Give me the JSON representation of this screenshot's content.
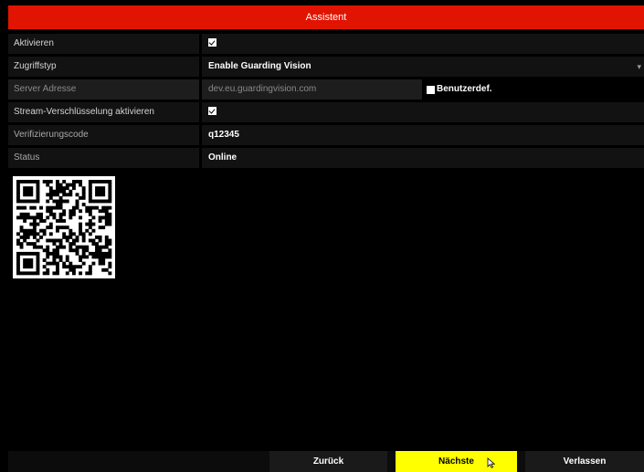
{
  "window": {
    "title": "Assistent"
  },
  "form": {
    "enable": {
      "label": "Aktivieren",
      "checked": true
    },
    "access_type": {
      "label": "Zugriffstyp",
      "value": "Enable Guarding Vision",
      "arrow": "▾"
    },
    "server_address": {
      "label": "Server Adresse",
      "value": "dev.eu.guardingvision.com",
      "custom_label": "Benutzerdef.",
      "custom_checked": false
    },
    "stream_encryption": {
      "label": "Stream-Verschlüsselung aktivieren",
      "checked": true
    },
    "verification_code": {
      "label": "Verifizierungscode",
      "value": "q12345"
    },
    "status": {
      "label": "Status",
      "value": "Online"
    }
  },
  "buttons": {
    "back": "Zurück",
    "next": "Nächste",
    "exit": "Verlassen"
  },
  "colors": {
    "titlebar": "#e01400",
    "primary_button": "#ffff00"
  },
  "icons": {
    "qr": "qr-code-icon",
    "cursor": "mouse-pointer-icon",
    "dropdown": "chevron-down-icon"
  }
}
